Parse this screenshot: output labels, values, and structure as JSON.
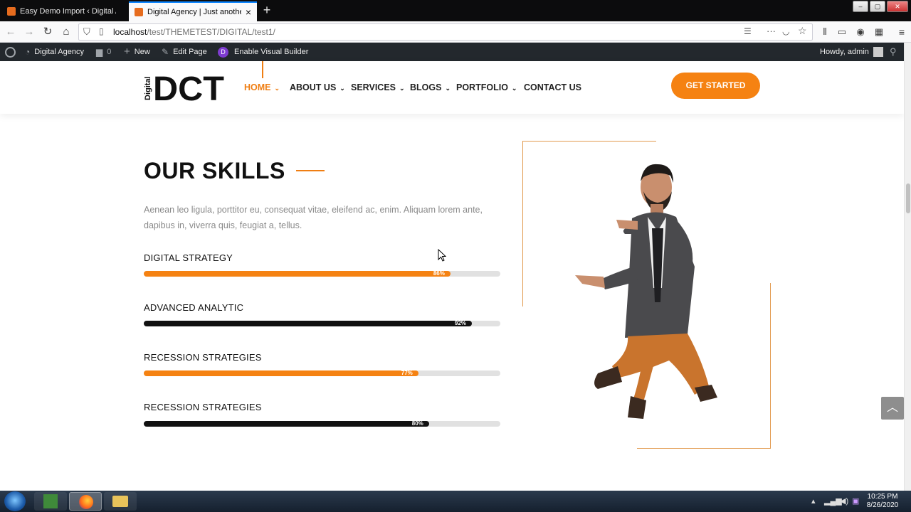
{
  "browser": {
    "tabs": [
      {
        "title": "Easy Demo Import ‹ Digital Agency",
        "active": false
      },
      {
        "title": "Digital Agency | Just another WordPress site",
        "active": true
      }
    ],
    "url_host": "localhost",
    "url_path": "/test/THEMETEST/DIGITAL/test1/"
  },
  "wp_admin_bar": {
    "site_name": "Digital Agency",
    "comments_count": "0",
    "new_label": "New",
    "edit_page_label": "Edit Page",
    "visual_builder_label": "Enable Visual Builder",
    "greeting": "Howdy, admin"
  },
  "header": {
    "logo_small": "Digital",
    "logo_big": "DCT",
    "menu": [
      {
        "label": "HOME",
        "has_dropdown": true,
        "active": true
      },
      {
        "label": "ABOUT US",
        "has_dropdown": true,
        "active": false
      },
      {
        "label": "SERVICES",
        "has_dropdown": true,
        "active": false
      },
      {
        "label": "BLOGS",
        "has_dropdown": true,
        "active": false
      },
      {
        "label": "PORTFOLIO",
        "has_dropdown": true,
        "active": false
      },
      {
        "label": "CONTACT US",
        "has_dropdown": false,
        "active": false
      }
    ],
    "cta_label": "GET STARTED"
  },
  "skills": {
    "title": "OUR SKILLS",
    "description": "Aenean leo ligula, porttitor eu, consequat vitae, eleifend ac, enim. Aliquam lorem ante, dapibus in, viverra quis, feugiat a, tellus.",
    "items": [
      {
        "label": "DIGITAL STRATEGY",
        "percent": 86,
        "percent_label": "86%",
        "color": "#f58212"
      },
      {
        "label": "ADVANCED ANALYTIC",
        "percent": 92,
        "percent_label": "92%",
        "color": "#111111"
      },
      {
        "label": "RECESSION STRATEGIES",
        "percent": 77,
        "percent_label": "77%",
        "color": "#f58212"
      },
      {
        "label": "RECESSION STRATEGIES",
        "percent": 80,
        "percent_label": "80%",
        "color": "#111111"
      }
    ]
  },
  "taskbar": {
    "time": "10:25 PM",
    "date": "8/26/2020"
  },
  "colors": {
    "accent": "#f58212",
    "dark": "#111111"
  }
}
